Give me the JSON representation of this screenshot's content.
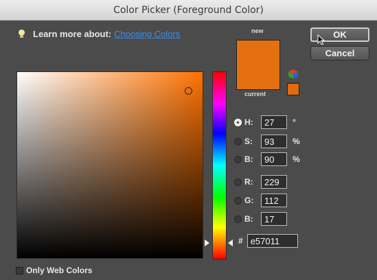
{
  "window": {
    "title": "Color Picker (Foreground Color)"
  },
  "learn_more": {
    "prefix": "Learn more about:",
    "link": "Choosing Colors"
  },
  "swatches": {
    "new_label": "new",
    "current_label": "current",
    "new_color": "#e57011",
    "current_color": "#e57011"
  },
  "buttons": {
    "ok": "OK",
    "cancel": "Cancel"
  },
  "hsb": [
    {
      "label": "H:",
      "value": "27",
      "unit": "°",
      "selected": true
    },
    {
      "label": "S:",
      "value": "93",
      "unit": "%",
      "selected": false
    },
    {
      "label": "B:",
      "value": "90",
      "unit": "%",
      "selected": false
    }
  ],
  "rgb": [
    {
      "label": "R:",
      "value": "229",
      "selected": false
    },
    {
      "label": "G:",
      "value": "112",
      "selected": false
    },
    {
      "label": "B:",
      "value": "17",
      "selected": false
    }
  ],
  "hex": {
    "label": "#",
    "value": "e57011"
  },
  "web_colors": {
    "label": "Only Web Colors",
    "checked": false
  },
  "colors": {
    "accent": "#e57011",
    "link": "#3d8fe8",
    "hue_base": "#ff7200"
  },
  "icons": {
    "tip": "lightbulb-icon",
    "gamut": "color-cube-icon",
    "pointer": "mouse-pointer-icon"
  }
}
